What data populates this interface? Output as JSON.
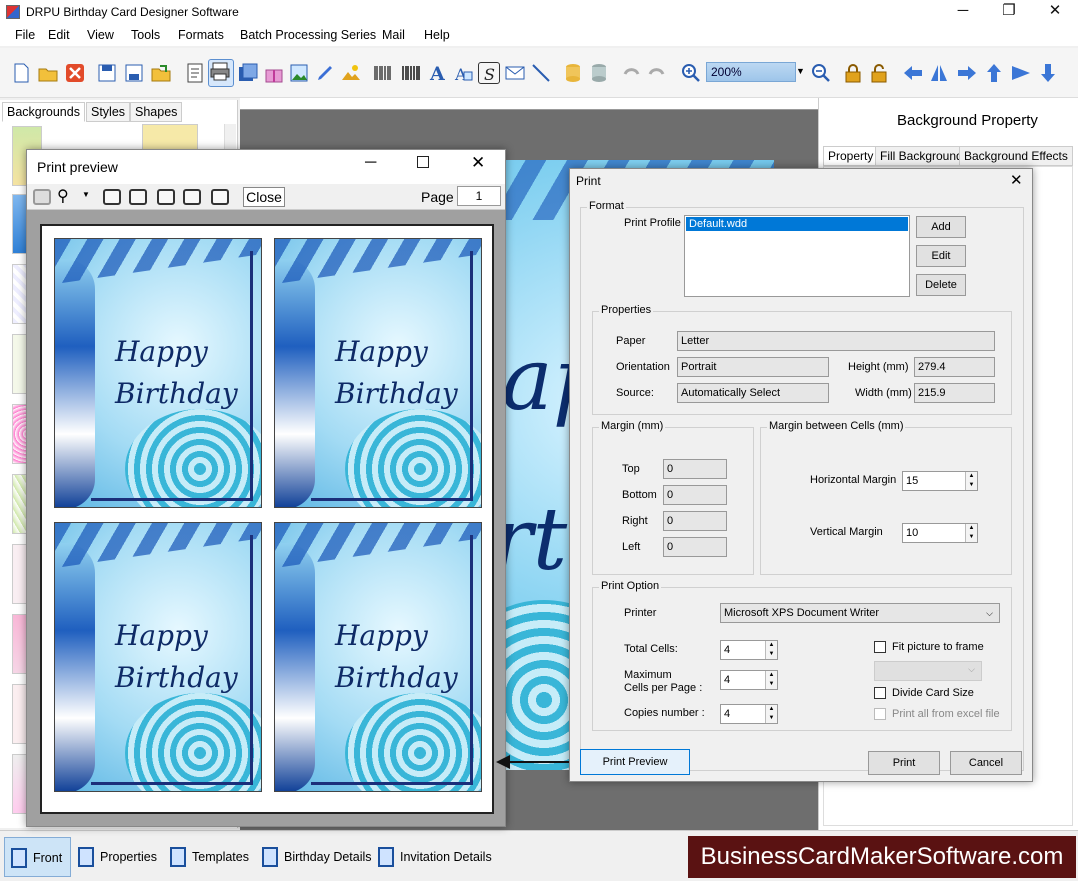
{
  "window": {
    "title": "DRPU Birthday Card Designer Software",
    "minimize": "─",
    "maximize": "❐",
    "close": "✕"
  },
  "menu": [
    "File",
    "Edit",
    "View",
    "Tools",
    "Formats",
    "Batch Processing Series",
    "Mail",
    "Help"
  ],
  "toolbar": {
    "zoom_value": "200%"
  },
  "left_panel": {
    "tabs": [
      "Backgrounds",
      "Styles",
      "Shapes"
    ]
  },
  "right_panel": {
    "title": "Background Property",
    "tabs": [
      "Property",
      "Fill Background",
      "Background Effects"
    ]
  },
  "bottom_tabs": [
    "Front",
    "Properties",
    "Templates",
    "Birthday Details",
    "Invitation Details"
  ],
  "brand": "BusinessCardMakerSoftware.com",
  "print_preview": {
    "title": "Print preview",
    "close_label": "Close",
    "page_label": "Page",
    "page_value": "1",
    "card_line1": "Happy",
    "card_line2": "Birthday"
  },
  "print_dialog": {
    "title": "Print",
    "format_label": "Format",
    "print_profile_label": "Print Profile",
    "profile_item": "Default.wdd",
    "add": "Add",
    "edit": "Edit",
    "delete": "Delete",
    "properties_label": "Properties",
    "paper_label": "Paper",
    "paper_value": "Letter",
    "orientation_label": "Orientation",
    "orientation_value": "Portrait",
    "source_label": "Source:",
    "source_value": "Automatically Select",
    "height_label": "Height (mm)",
    "height_value": "279.4",
    "width_label": "Width (mm)",
    "width_value": "215.9",
    "margin_label": "Margin (mm)",
    "top_label": "Top",
    "top_value": "0",
    "bottom_label": "Bottom",
    "bottom_value": "0",
    "right_label": "Right",
    "right_value": "0",
    "left_label": "Left",
    "left_value": "0",
    "cells_margin_label": "Margin between Cells (mm)",
    "hmargin_label": "Horizontal Margin",
    "hmargin_value": "15",
    "vmargin_label": "Vertical Margin",
    "vmargin_value": "10",
    "print_option_label": "Print Option",
    "printer_label": "Printer",
    "printer_value": "Microsoft XPS Document Writer",
    "total_cells_label": "Total Cells:",
    "total_cells_value": "4",
    "max_cells_label_1": "Maximum",
    "max_cells_label_2": "Cells per Page :",
    "max_cells_value": "4",
    "copies_label": "Copies number :",
    "copies_value": "4",
    "fit_label": "Fit picture to frame",
    "divide_label": "Divide Card Size",
    "print_all_label": "Print all from excel file",
    "preview_btn": "Print Preview",
    "print_btn": "Print",
    "cancel_btn": "Cancel"
  },
  "canvas": {
    "text1": "lapp",
    "text2": "irth"
  }
}
